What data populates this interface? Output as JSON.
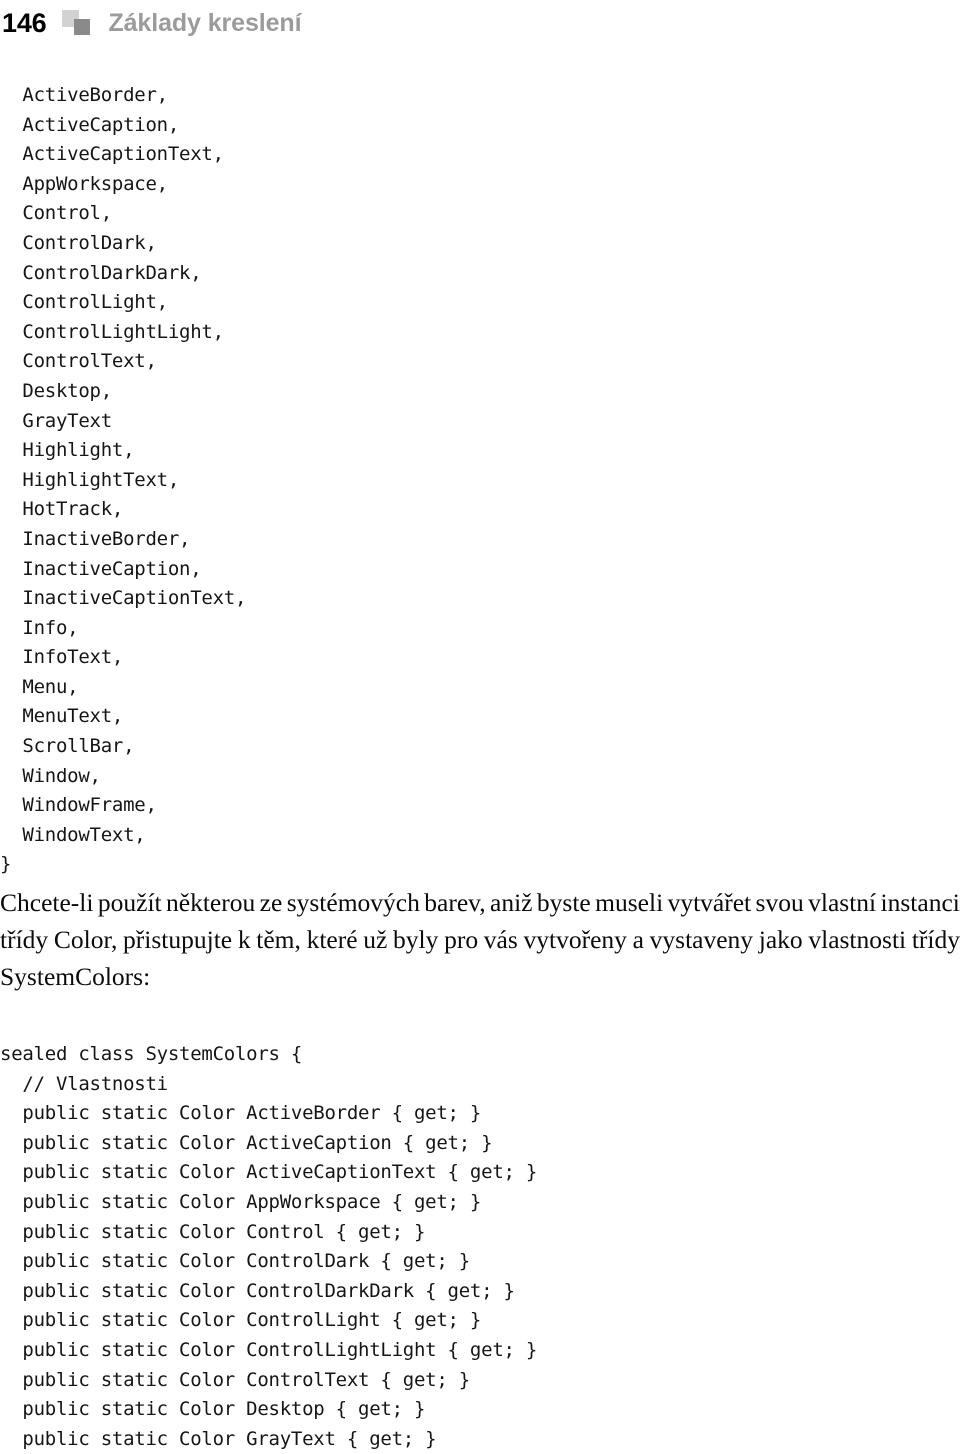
{
  "header": {
    "folio": "146",
    "title": "Základy kreslení",
    "icon_light": "square-light-icon",
    "icon_dark": "square-dark-icon",
    "color_folio": "#000000",
    "color_title": "#9b9b9b",
    "color_icon_light": "#d2d2d2",
    "color_icon_dark": "#8a8a8a"
  },
  "code_block_enum": {
    "lines": [
      "  ActiveBorder,",
      "  ActiveCaption,",
      "  ActiveCaptionText,",
      "  AppWorkspace,",
      "  Control,",
      "  ControlDark,",
      "  ControlDarkDark,",
      "  ControlLight,",
      "  ControlLightLight,",
      "  ControlText,",
      "  Desktop,",
      "  GrayText",
      "  Highlight,",
      "  HighlightText,",
      "  HotTrack,",
      "  InactiveBorder,",
      "  InactiveCaption,",
      "  InactiveCaptionText,",
      "  Info,",
      "  InfoText,",
      "  Menu,",
      "  MenuText,",
      "  ScrollBar,",
      "  Window,",
      "  WindowFrame,",
      "  WindowText,",
      "}"
    ]
  },
  "paragraph": {
    "line1_words": [
      "Chcete-li",
      "použít",
      "některou",
      "ze",
      "systémových",
      "barev,",
      "aniž",
      "byste",
      "museli",
      "vytvářet",
      "svou",
      "vlastní",
      "instanci"
    ],
    "line2_words": [
      "třídy",
      "Color,",
      "přistupujte",
      "k",
      "těm,",
      "které",
      "už",
      "byly",
      "pro",
      "vás",
      "vytvořeny",
      "a",
      "vystaveny",
      "jako",
      "vlastnosti",
      "třídy"
    ],
    "line3": "SystemColors:",
    "full_text": "Chcete-li použít některou ze systémových barev, aniž byste museli vytvářet svou vlastní instanci třídy Color, přistupujte k těm, které už byly pro vás vytvořeny a vystaveny jako vlastnosti třídy SystemColors:"
  },
  "code_block_class": {
    "lines": [
      "sealed class SystemColors {",
      "  // Vlastnosti",
      "  public static Color ActiveBorder { get; }",
      "  public static Color ActiveCaption { get; }",
      "  public static Color ActiveCaptionText { get; }",
      "  public static Color AppWorkspace { get; }",
      "  public static Color Control { get; }",
      "  public static Color ControlDark { get; }",
      "  public static Color ControlDarkDark { get; }",
      "  public static Color ControlLight { get; }",
      "  public static Color ControlLightLight { get; }",
      "  public static Color ControlText { get; }",
      "  public static Color Desktop { get; }",
      "  public static Color GrayText { get; }"
    ]
  }
}
